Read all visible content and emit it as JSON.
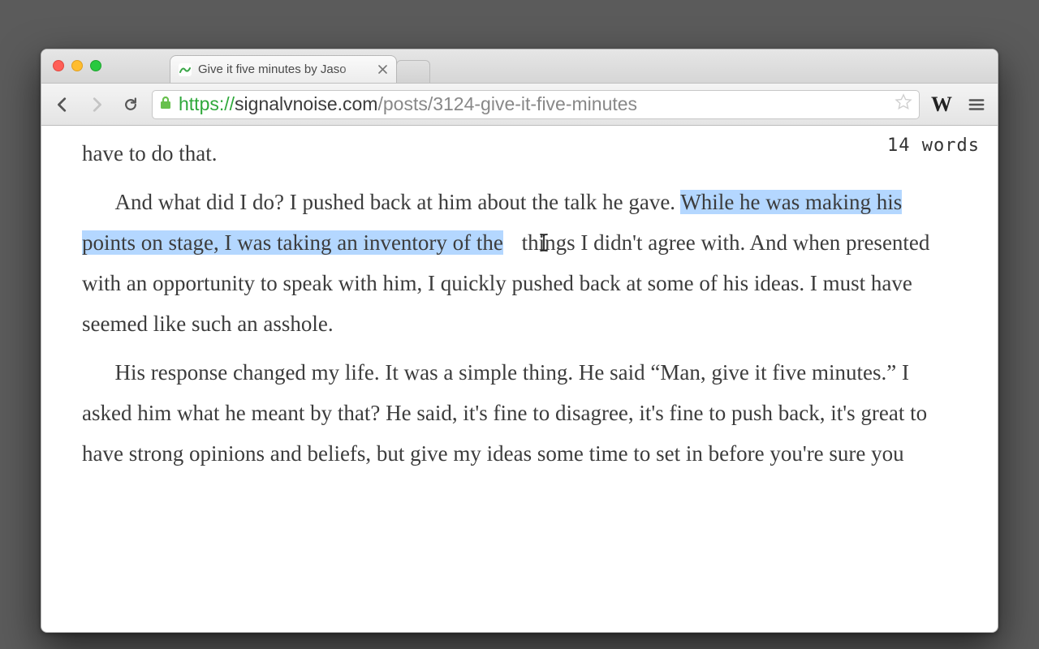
{
  "tab": {
    "title": "Give it five minutes by Jaso"
  },
  "url": {
    "scheme": "https://",
    "host": "signalvnoise.com",
    "path": "/posts/3124-give-it-five-minutes"
  },
  "extension": {
    "word_counter_label": "W",
    "count_text": "14 words"
  },
  "article": {
    "p0": "have to do that.",
    "p1_before": "And what did I do? I pushed back at him about the talk he gave. ",
    "p1_highlight": "While he was making his points on stage, I was taking an inventory of the",
    "p1_after": " things I didn't agree with. And when presented with an opportunity to speak with him, I quickly pushed back at some of his ideas. I must have seemed like such an asshole.",
    "p2": "His response changed my life. It was a simple thing. He said “Man, give it five minutes.” I asked him what he meant by that? He said, it's fine to disagree, it's fine to push back, it's great to have strong opinions and beliefs, but give my ideas some time to set in before you're sure you"
  }
}
